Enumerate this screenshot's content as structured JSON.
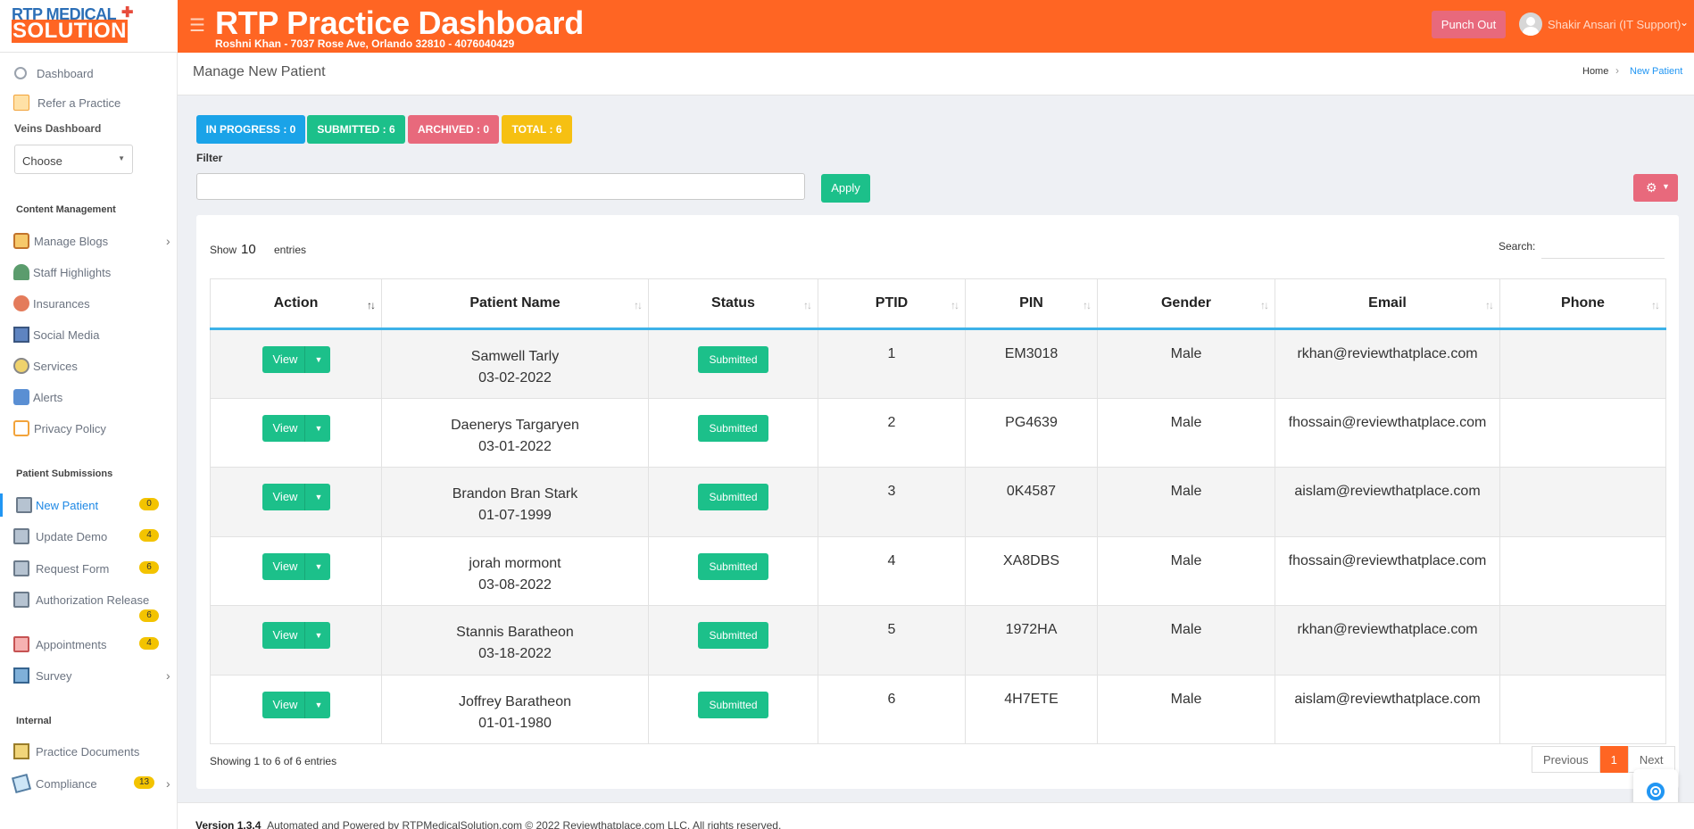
{
  "logo": {
    "top": "RTP MEDICAL",
    "bottom": "SOLUTION"
  },
  "header": {
    "title": "RTP Practice Dashboard",
    "subtitle": "Roshni Khan - 7037 Rose Ave, Orlando 32810 - 4076040429",
    "punch_out": "Punch Out",
    "user": "Shakir Ansari (IT Support)"
  },
  "sidebar": {
    "dashboard": "Dashboard",
    "refer": "Refer a Practice",
    "veins_label": "Veins Dashboard",
    "veins_select": "Choose",
    "content_head": "Content Management",
    "items": [
      {
        "label": "Manage Blogs",
        "icon": "blog-icon"
      },
      {
        "label": "Staff Highlights",
        "icon": "staff-icon"
      },
      {
        "label": "Insurances",
        "icon": "insurance-icon"
      },
      {
        "label": "Social Media",
        "icon": "social-media-icon"
      },
      {
        "label": "Services",
        "icon": "services-icon"
      },
      {
        "label": "Alerts",
        "icon": "alerts-icon"
      },
      {
        "label": "Privacy Policy",
        "icon": "privacy-icon"
      }
    ],
    "patient_head": "Patient Submissions",
    "patient_items": [
      {
        "label": "New Patient",
        "badge": "0"
      },
      {
        "label": "Update Demo",
        "badge": "4"
      },
      {
        "label": "Request Form",
        "badge": "6"
      },
      {
        "label": "Authorization Release",
        "badge": "6"
      },
      {
        "label": "Appointments",
        "badge": "4"
      },
      {
        "label": "Survey"
      }
    ],
    "internal_head": "Internal",
    "internal_items": [
      {
        "label": "Practice Documents"
      },
      {
        "label": "Compliance",
        "badge": "13"
      }
    ]
  },
  "page": {
    "title": "Manage New Patient",
    "crumb_home": "Home",
    "crumb_current": "New Patient"
  },
  "stats": {
    "in_progress": "IN PROGRESS : 0",
    "submitted": "SUBMITTED : 6",
    "archived": "ARCHIVED : 0",
    "total": "TOTAL : 6"
  },
  "filter": {
    "label": "Filter",
    "value": "",
    "apply": "Apply"
  },
  "table": {
    "show": "Show",
    "show_value": "10",
    "entries": "entries",
    "search_label": "Search:",
    "columns": [
      "Action",
      "Patient Name",
      "Status",
      "PTID",
      "PIN",
      "Gender",
      "Email",
      "Phone"
    ],
    "rows": [
      {
        "name": "Samwell Tarly",
        "dob": "03-02-2022",
        "status": "Submitted",
        "ptid": "1",
        "pin": "EM3018",
        "gender": "Male",
        "email": "rkhan@reviewthatplace.com",
        "phone": ""
      },
      {
        "name": "Daenerys Targaryen",
        "dob": "03-01-2022",
        "status": "Submitted",
        "ptid": "2",
        "pin": "PG4639",
        "gender": "Male",
        "email": "fhossain@reviewthatplace.com",
        "phone": ""
      },
      {
        "name": "Brandon Bran Stark",
        "dob": "01-07-1999",
        "status": "Submitted",
        "ptid": "3",
        "pin": "0K4587",
        "gender": "Male",
        "email": "aislam@reviewthatplace.com",
        "phone": ""
      },
      {
        "name": "jorah mormont",
        "dob": "03-08-2022",
        "status": "Submitted",
        "ptid": "4",
        "pin": "XA8DBS",
        "gender": "Male",
        "email": "fhossain@reviewthatplace.com",
        "phone": ""
      },
      {
        "name": "Stannis Baratheon",
        "dob": "03-18-2022",
        "status": "Submitted",
        "ptid": "5",
        "pin": "1972HA",
        "gender": "Male",
        "email": "rkhan@reviewthatplace.com",
        "phone": ""
      },
      {
        "name": "Joffrey Baratheon",
        "dob": "01-01-1980",
        "status": "Submitted",
        "ptid": "6",
        "pin": "4H7ETE",
        "gender": "Male",
        "email": "aislam@reviewthatplace.com",
        "phone": ""
      }
    ],
    "view_label": "View",
    "info": "Showing 1 to 6 of 6 entries",
    "prev": "Previous",
    "page": "1",
    "next": "Next"
  },
  "footer": {
    "version": "Version 1.3.4",
    "text": "Automated and Powered by RTPMedicalSolution.com © 2022 Reviewthatplace.com LLC. All rights reserved."
  },
  "colors": {
    "brand": "#ff6523",
    "green": "#1cc08a",
    "red": "#e8697c",
    "blue": "#1aa3e8",
    "yellow": "#f6c012"
  }
}
